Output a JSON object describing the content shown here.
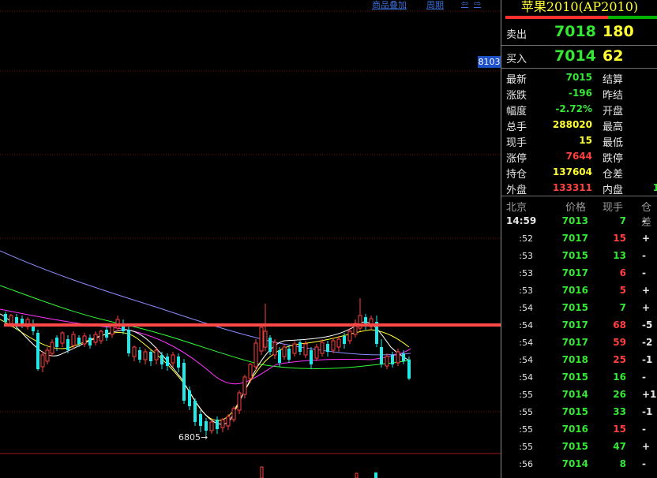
{
  "toolbar": {
    "overlay_label": "商品叠加",
    "period_label": "周期",
    "nav_prev": "⇦",
    "nav_next": "⇨"
  },
  "chart": {
    "axis_tag": "8103",
    "low_annotation": "6805→",
    "colors": {
      "up": "#ff4040",
      "down": "#22e8e8",
      "resistance_line": "#ff4848",
      "ma": [
        "#ffffff",
        "#ffff33",
        "#ff33ff",
        "#33ff33",
        "#8c8cff"
      ]
    }
  },
  "quote": {
    "title": "苹果2010(AP2010)",
    "ask": {
      "label": "卖出",
      "price": "7018",
      "volume": "180"
    },
    "bid": {
      "label": "买入",
      "price": "7014",
      "volume": "62"
    }
  },
  "stats": [
    {
      "label": "最新",
      "value": "7015",
      "color": "#35e635",
      "label2": "结算",
      "value2": ""
    },
    {
      "label": "涨跌",
      "value": "-196",
      "color": "#35e635",
      "label2": "昨结",
      "value2": ""
    },
    {
      "label": "幅度",
      "value": "-2.72%",
      "color": "#35e635",
      "label2": "开盘",
      "value2": ""
    },
    {
      "label": "总手",
      "value": "288020",
      "color": "#ffff33",
      "label2": "最高",
      "value2": ""
    },
    {
      "label": "现手",
      "value": "15",
      "color": "#ffff33",
      "label2": "最低",
      "value2": ""
    },
    {
      "label": "涨停",
      "value": "7644",
      "color": "#ff4040",
      "label2": "跌停",
      "value2": ""
    },
    {
      "label": "持仓",
      "value": "137604",
      "color": "#ffff33",
      "label2": "仓差",
      "value2": ""
    },
    {
      "label": "外盘",
      "value": "133311",
      "color": "#ff4040",
      "label2": "内盘",
      "value2": "1"
    }
  ],
  "ticks": {
    "headers": [
      "北京",
      "价格",
      "现手",
      "仓差"
    ],
    "rows": [
      {
        "time": "14:59",
        "price": "7013",
        "vol": "7",
        "vol_color": "#35e635",
        "oi": "-",
        "oi_color": "#e6e6e6"
      },
      {
        "time": ":52",
        "price": "7017",
        "vol": "15",
        "vol_color": "#ff4040",
        "oi": "+",
        "oi_color": "#e6e6e6"
      },
      {
        "time": ":53",
        "price": "7015",
        "vol": "13",
        "vol_color": "#35e635",
        "oi": "-",
        "oi_color": "#e6e6e6"
      },
      {
        "time": ":53",
        "price": "7017",
        "vol": "6",
        "vol_color": "#ff4040",
        "oi": "-",
        "oi_color": "#e6e6e6"
      },
      {
        "time": ":53",
        "price": "7016",
        "vol": "5",
        "vol_color": "#ff4040",
        "oi": "+",
        "oi_color": "#e6e6e6"
      },
      {
        "time": ":54",
        "price": "7015",
        "vol": "7",
        "vol_color": "#35e635",
        "oi": "+",
        "oi_color": "#e6e6e6"
      },
      {
        "time": ":54",
        "price": "7017",
        "vol": "68",
        "vol_color": "#ff4040",
        "oi": "-5",
        "oi_color": "#e6e6e6"
      },
      {
        "time": ":54",
        "price": "7017",
        "vol": "59",
        "vol_color": "#ff4040",
        "oi": "-2",
        "oi_color": "#e6e6e6"
      },
      {
        "time": ":54",
        "price": "7018",
        "vol": "25",
        "vol_color": "#ff4040",
        "oi": "-1",
        "oi_color": "#e6e6e6"
      },
      {
        "time": ":54",
        "price": "7015",
        "vol": "16",
        "vol_color": "#35e635",
        "oi": "-",
        "oi_color": "#e6e6e6"
      },
      {
        "time": ":55",
        "price": "7014",
        "vol": "26",
        "vol_color": "#35e635",
        "oi": "+1",
        "oi_color": "#e6e6e6"
      },
      {
        "time": ":55",
        "price": "7015",
        "vol": "33",
        "vol_color": "#35e635",
        "oi": "-1",
        "oi_color": "#e6e6e6"
      },
      {
        "time": ":55",
        "price": "7016",
        "vol": "15",
        "vol_color": "#ff4040",
        "oi": "-",
        "oi_color": "#e6e6e6"
      },
      {
        "time": ":55",
        "price": "7015",
        "vol": "47",
        "vol_color": "#35e635",
        "oi": "+",
        "oi_color": "#e6e6e6"
      },
      {
        "time": ":56",
        "price": "7014",
        "vol": "8",
        "vol_color": "#35e635",
        "oi": "-",
        "oi_color": "#e6e6e6"
      }
    ]
  }
}
